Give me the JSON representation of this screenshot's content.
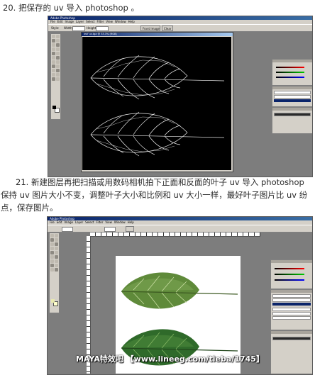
{
  "step20": {
    "text": "20. 把保存的 uv 导入 photoshop 。"
  },
  "step21": {
    "line1": "21. 新建图层再把扫描或用数码相机拍下正面和反面的叶子 uv 导入 photoshop",
    "line2": "保持 uv 图片大小不变，调整叶子大小和比例和 uv 大小一样，最好叶子图片比 uv 纷",
    "line3": "点，保存图片。"
  },
  "screenshot1": {
    "app_title": "Adobe Photoshop",
    "menu": [
      "File",
      "Edit",
      "Image",
      "Layer",
      "Select",
      "Filter",
      "View",
      "Window",
      "Help"
    ],
    "options": {
      "style_label": "Style:",
      "width_label": "Width:",
      "height_label": "Height:",
      "front_image": "Front Image",
      "clear": "Clear"
    },
    "document_title": "leaf uv.tga @ 33.3% (RGB)",
    "layer_names": [
      "Layer 1",
      "Layer 1 bg",
      "Uvs"
    ]
  },
  "screenshot2": {
    "app_title": "Adobe Photoshop",
    "menu": [
      "File",
      "Edit",
      "Image",
      "Layer",
      "Select",
      "Filter",
      "View",
      "Window",
      "Help"
    ],
    "layer_names": [
      "Layer 1",
      "Layer 1 bg",
      "Uvs",
      "Drop Shadow",
      "Drop Shadow"
    ]
  },
  "watermark": "MAYA特效吧 【www.lineeg.com/tieba/1745】",
  "colors": {
    "desktop": "#7d7d7d",
    "chrome": "#d4d0c8",
    "titlebar": "#0a246a",
    "uv_canvas": "#000000",
    "leaf_green": "#4a7a2a"
  }
}
